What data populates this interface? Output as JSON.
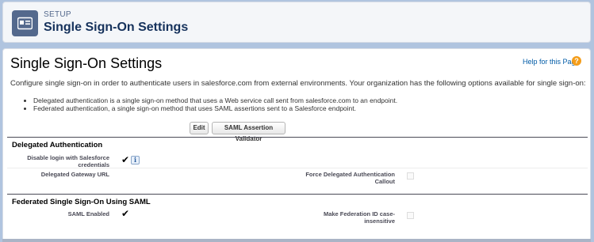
{
  "header": {
    "breadcrumb": "SETUP",
    "title": "Single Sign-On Settings",
    "icon": "id-card-icon"
  },
  "main": {
    "title": "Single Sign-On Settings",
    "help_link": "Help for this Page",
    "help_icon": "?",
    "intro": "Configure single sign-on in order to authenticate users in salesforce.com from external environments. Your organization has the following options available for single sign-on:",
    "bullets": [
      "Delegated authentication is a single sign-on method that uses a Web service call sent from salesforce.com to an endpoint.",
      "Federated authentication, a single sign-on method that uses SAML assertions sent to a Salesforce endpoint."
    ],
    "buttons": {
      "edit": "Edit",
      "saml_validator": "SAML Assertion Validator"
    }
  },
  "delegated": {
    "title": "Delegated Authentication",
    "disable_login_label_line1": "Disable login with Salesforce",
    "disable_login_label_line2": "credentials",
    "disable_login_value": "✔",
    "info_icon": "i",
    "gateway_url_label": "Delegated Gateway URL",
    "force_callout_label_line1": "Force Delegated Authentication",
    "force_callout_label_line2": "Callout"
  },
  "federated": {
    "title": "Federated Single Sign-On Using SAML",
    "saml_enabled_label": "SAML Enabled",
    "saml_enabled_value": "✔",
    "fed_id_label_line1": "Make Federation ID case-",
    "fed_id_label_line2": "insensitive"
  },
  "colors": {
    "background": "#b0c4df",
    "header_icon": "#54698d",
    "help_icon": "#f49d1a",
    "link": "#015ba7"
  }
}
